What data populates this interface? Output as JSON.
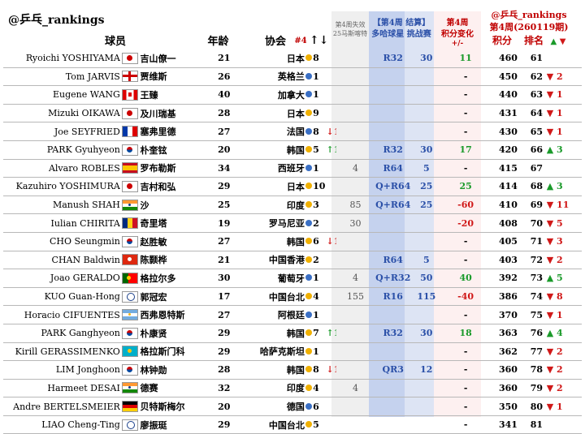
{
  "header": {
    "title": "@乒乓_rankings",
    "col_player": "球员",
    "col_age": "年龄",
    "col_assoc": "协会",
    "col_num4": "#4",
    "col_arrows": "↑↓",
    "col_lost_line1": "第4周失效",
    "col_lost_line2": "25马斯喀特",
    "col_result_line1": "【第4周 结算】",
    "col_result_line2": "多哈球星 挑战赛",
    "col_change_line1": "第4周",
    "col_change_line2": "积分变化",
    "col_change_line3": "+/-",
    "col_week_line1": "@乒乓_rankings",
    "col_week_line2": "第4周(260119期)",
    "col_points": "积分",
    "col_rank": "排名",
    "col_rank_arrows": "▲ ▼"
  },
  "colors": {
    "blue_header": "#2b50a8",
    "red_header": "#c00000",
    "green": "#1a9a2a",
    "red": "#d01818",
    "gold_dot": "#f0b000",
    "blue_dot": "#3a6fc4"
  },
  "rows": [
    {
      "en": "Ryoichi YOSHIYAMA",
      "cn": "吉山僚一",
      "flag": "jp",
      "age": "21",
      "nat": "日本",
      "dot": "gold",
      "num4": "8",
      "arr": "",
      "arrc": "",
      "lost": "",
      "hr": "R32",
      "ch": "30",
      "chg": "11",
      "chgc": "green",
      "pts": "460",
      "rank": "61",
      "mv": "",
      "mvc": ""
    },
    {
      "en": "Tom JARVIS",
      "cn": "贾维斯",
      "flag": "eng",
      "age": "26",
      "nat": "英格兰",
      "dot": "blue",
      "num4": "1",
      "arr": "",
      "arrc": "",
      "lost": "",
      "hr": "",
      "ch": "",
      "chg": "-",
      "chgc": "",
      "pts": "450",
      "rank": "62",
      "mv": "▼ 2",
      "mvc": "red"
    },
    {
      "en": "Eugene WANG",
      "cn": "王臻",
      "flag": "ca",
      "age": "40",
      "nat": "加拿大",
      "dot": "blue",
      "num4": "1",
      "arr": "",
      "arrc": "",
      "lost": "",
      "hr": "",
      "ch": "",
      "chg": "-",
      "chgc": "",
      "pts": "440",
      "rank": "63",
      "mv": "▼ 1",
      "mvc": "red"
    },
    {
      "en": "Mizuki OIKAWA",
      "cn": "及川瑞基",
      "flag": "jp",
      "age": "28",
      "nat": "日本",
      "dot": "gold",
      "num4": "9",
      "arr": "",
      "arrc": "",
      "lost": "",
      "hr": "",
      "ch": "",
      "chg": "-",
      "chgc": "",
      "pts": "431",
      "rank": "64",
      "mv": "▼ 1",
      "mvc": "red"
    },
    {
      "en": "Joe SEYFRIED",
      "cn": "塞弗里德",
      "flag": "fr",
      "age": "27",
      "nat": "法国",
      "dot": "blue",
      "num4": "8",
      "arr": "↓1",
      "arrc": "red",
      "lost": "",
      "hr": "",
      "ch": "",
      "chg": "-",
      "chgc": "",
      "pts": "430",
      "rank": "65",
      "mv": "▼ 1",
      "mvc": "red"
    },
    {
      "en": "PARK Gyuhyeon",
      "cn": "朴奎铉",
      "flag": "kr",
      "age": "20",
      "nat": "韩国",
      "dot": "gold",
      "num4": "5",
      "arr": "↑1",
      "arrc": "green",
      "lost": "",
      "hr": "R32",
      "ch": "30",
      "chg": "17",
      "chgc": "green",
      "pts": "420",
      "rank": "66",
      "mv": "▲ 3",
      "mvc": "green"
    },
    {
      "en": "Alvaro ROBLES",
      "cn": "罗布勒斯",
      "flag": "es",
      "age": "34",
      "nat": "西班牙",
      "dot": "blue",
      "num4": "1",
      "arr": "",
      "arrc": "",
      "lost": "4",
      "hr": "R64",
      "ch": "5",
      "chg": "-",
      "chgc": "",
      "pts": "415",
      "rank": "67",
      "mv": "",
      "mvc": ""
    },
    {
      "en": "Kazuhiro YOSHIMURA",
      "cn": "吉村和弘",
      "flag": "jp",
      "age": "29",
      "nat": "日本",
      "dot": "gold",
      "num4": "10",
      "arr": "",
      "arrc": "",
      "lost": "",
      "hr": "Q+R64",
      "ch": "25",
      "chg": "25",
      "chgc": "green",
      "pts": "414",
      "rank": "68",
      "mv": "▲ 3",
      "mvc": "green"
    },
    {
      "en": "Manush SHAH",
      "cn": "沙",
      "flag": "in",
      "age": "25",
      "nat": "印度",
      "dot": "gold",
      "num4": "3",
      "arr": "",
      "arrc": "",
      "lost": "85",
      "hr": "Q+R64",
      "ch": "25",
      "chg": "-60",
      "chgc": "red",
      "pts": "410",
      "rank": "69",
      "mv": "▼ 11",
      "mvc": "red"
    },
    {
      "en": "Iulian CHIRITA",
      "cn": "奇里塔",
      "flag": "ro",
      "age": "19",
      "nat": "罗马尼亚",
      "dot": "blue",
      "num4": "2",
      "arr": "",
      "arrc": "",
      "lost": "30",
      "hr": "",
      "ch": "",
      "chg": "-20",
      "chgc": "red",
      "pts": "408",
      "rank": "70",
      "mv": "▼ 5",
      "mvc": "red"
    },
    {
      "en": "CHO Seungmin",
      "cn": "赵胜敏",
      "flag": "kr",
      "age": "27",
      "nat": "韩国",
      "dot": "gold",
      "num4": "6",
      "arr": "↓1",
      "arrc": "red",
      "lost": "",
      "hr": "",
      "ch": "",
      "chg": "-",
      "chgc": "",
      "pts": "405",
      "rank": "71",
      "mv": "▼ 3",
      "mvc": "red"
    },
    {
      "en": "CHAN Baldwin",
      "cn": "陈颢桦",
      "flag": "hk",
      "age": "21",
      "nat": "中国香港",
      "dot": "gold",
      "num4": "2",
      "arr": "",
      "arrc": "",
      "lost": "",
      "hr": "R64",
      "ch": "5",
      "chg": "-",
      "chgc": "",
      "pts": "403",
      "rank": "72",
      "mv": "▼ 2",
      "mvc": "red"
    },
    {
      "en": "Joao GERALDO",
      "cn": "格拉尔多",
      "flag": "pt",
      "age": "30",
      "nat": "葡萄牙",
      "dot": "blue",
      "num4": "1",
      "arr": "",
      "arrc": "",
      "lost": "4",
      "hr": "Q+R32",
      "ch": "50",
      "chg": "40",
      "chgc": "green",
      "pts": "392",
      "rank": "73",
      "mv": "▲ 5",
      "mvc": "green"
    },
    {
      "en": "KUO Guan-Hong",
      "cn": "郭冠宏",
      "flag": "tpe",
      "age": "17",
      "nat": "中国台北",
      "dot": "gold",
      "num4": "4",
      "arr": "",
      "arrc": "",
      "lost": "155",
      "hr": "R16",
      "ch": "115",
      "chg": "-40",
      "chgc": "red",
      "pts": "386",
      "rank": "74",
      "mv": "▼ 8",
      "mvc": "red"
    },
    {
      "en": "Horacio CIFUENTES",
      "cn": "西弗恩特斯",
      "flag": "ar",
      "age": "27",
      "nat": "阿根廷",
      "dot": "blue",
      "num4": "1",
      "arr": "",
      "arrc": "",
      "lost": "",
      "hr": "",
      "ch": "",
      "chg": "-",
      "chgc": "",
      "pts": "370",
      "rank": "75",
      "mv": "▼ 1",
      "mvc": "red"
    },
    {
      "en": "PARK Ganghyeon",
      "cn": "朴康贤",
      "flag": "kr",
      "age": "29",
      "nat": "韩国",
      "dot": "gold",
      "num4": "7",
      "arr": "↑1",
      "arrc": "green",
      "lost": "",
      "hr": "R32",
      "ch": "30",
      "chg": "18",
      "chgc": "green",
      "pts": "363",
      "rank": "76",
      "mv": "▲ 4",
      "mvc": "green"
    },
    {
      "en": "Kirill GERASSIMENKO",
      "cn": "格拉斯门科",
      "flag": "kz",
      "age": "29",
      "nat": "哈萨克斯坦",
      "dot": "gold",
      "num4": "1",
      "arr": "",
      "arrc": "",
      "lost": "",
      "hr": "",
      "ch": "",
      "chg": "-",
      "chgc": "",
      "pts": "362",
      "rank": "77",
      "mv": "▼ 2",
      "mvc": "red"
    },
    {
      "en": "LIM Jonghoon",
      "cn": "林钟勋",
      "flag": "kr",
      "age": "28",
      "nat": "韩国",
      "dot": "gold",
      "num4": "8",
      "arr": "↓1",
      "arrc": "red",
      "lost": "",
      "hr": "QR3",
      "ch": "12",
      "chg": "-",
      "chgc": "",
      "pts": "360",
      "rank": "78",
      "mv": "▼ 2",
      "mvc": "red"
    },
    {
      "en": "Harmeet DESAI",
      "cn": "德赛",
      "flag": "in",
      "age": "32",
      "nat": "印度",
      "dot": "gold",
      "num4": "4",
      "arr": "",
      "arrc": "",
      "lost": "4",
      "hr": "",
      "ch": "",
      "chg": "-",
      "chgc": "",
      "pts": "360",
      "rank": "79",
      "mv": "▼ 2",
      "mvc": "red"
    },
    {
      "en": "Andre BERTELSMEIER",
      "cn": "贝特斯梅尔",
      "flag": "de",
      "age": "20",
      "nat": "德国",
      "dot": "blue",
      "num4": "6",
      "arr": "",
      "arrc": "",
      "lost": "",
      "hr": "",
      "ch": "",
      "chg": "-",
      "chgc": "",
      "pts": "350",
      "rank": "80",
      "mv": "▼ 1",
      "mvc": "red"
    },
    {
      "en": "LIAO Cheng-Ting",
      "cn": "廖振珽",
      "flag": "tpe",
      "age": "29",
      "nat": "中国台北",
      "dot": "gold",
      "num4": "5",
      "arr": "",
      "arrc": "",
      "lost": "",
      "hr": "",
      "ch": "",
      "chg": "-",
      "chgc": "",
      "pts": "341",
      "rank": "81",
      "mv": "",
      "mvc": ""
    }
  ]
}
